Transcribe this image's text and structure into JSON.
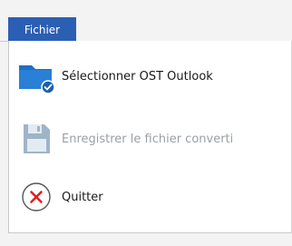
{
  "menubar": {
    "file_tab_label": "Fichier"
  },
  "menu": {
    "items": [
      {
        "label": "Sélectionner OST Outlook",
        "icon": "folder-check-icon",
        "enabled": true
      },
      {
        "label": "Enregistrer le fichier converti",
        "icon": "save-floppy-icon",
        "enabled": false
      },
      {
        "label": "Quitter",
        "icon": "close-circle-icon",
        "enabled": true
      }
    ]
  },
  "colors": {
    "accent": "#2b5fb4",
    "folder": "#1f6fc5",
    "disabled": "#9aa0a6",
    "exit_red": "#e02020"
  }
}
